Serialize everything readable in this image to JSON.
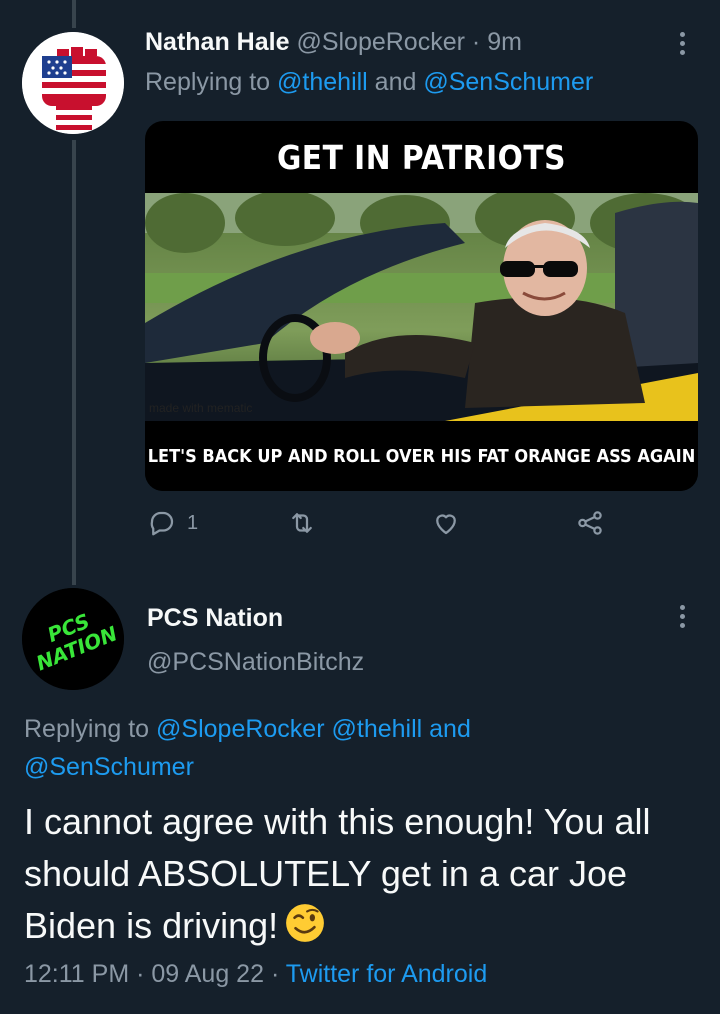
{
  "tweet1": {
    "name": "Nathan Hale",
    "handle": "@SlopeRocker",
    "separator": "·",
    "time": "9m",
    "replying_prefix": "Replying to ",
    "replying_user1": "@thehill",
    "replying_and": " and ",
    "replying_user2": "@SenSchumer",
    "meme": {
      "top_text": "GET IN PATRIOTS",
      "bottom_text": "LET'S BACK UP AND ROLL OVER HIS FAT ORANGE ASS AGAIN",
      "watermark": "made with mematic"
    },
    "actions": {
      "reply_count": "1",
      "retweet_count": "",
      "like_count": ""
    }
  },
  "tweet2": {
    "avatar_text": "PCS NATION",
    "name": "PCS Nation",
    "handle": "@PCSNationBitchz",
    "replying_prefix": "Replying to ",
    "replying_user1": "@SlopeRocker",
    "replying_user2": "@thehill",
    "replying_and": " and ",
    "replying_user3": "@SenSchumer",
    "body": "I cannot agree with this enough! You all should ABSOLUTELY get in a car Joe Biden is driving!",
    "emoji": "winking-face",
    "meta_time": "12:11 PM",
    "meta_sep": " · ",
    "meta_date": "09 Aug 22",
    "meta_source": "Twitter for Android"
  },
  "colors": {
    "background": "#15202b",
    "text": "#f7f9f9",
    "muted": "#8b98a5",
    "link": "#1d9bf0",
    "thread_line": "#38444d",
    "avatar_green": "#39e639"
  }
}
